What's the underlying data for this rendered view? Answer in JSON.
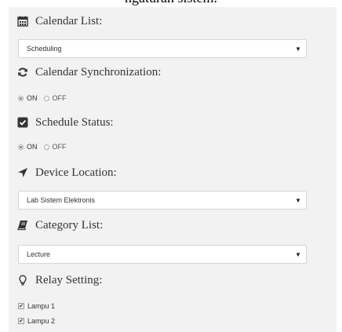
{
  "caption": "ngaturan sistem.",
  "calendar_list": {
    "label": "Calendar List:",
    "selected": "Scheduling"
  },
  "calendar_sync": {
    "label": "Calendar Synchronization:",
    "options": [
      "ON",
      "OFF"
    ],
    "selected": "ON"
  },
  "schedule_status": {
    "label": "Schedule Status:",
    "options": [
      "ON",
      "OFF"
    ],
    "selected": "ON"
  },
  "device_location": {
    "label": "Device Location:",
    "selected": "Lab Sistem Elektronis"
  },
  "category_list": {
    "label": "Category List:",
    "selected": "Lecture"
  },
  "relay_setting": {
    "label": "Relay Setting:",
    "items": [
      {
        "label": "Lampu 1",
        "checked": true
      },
      {
        "label": "Lampu 2",
        "checked": true
      }
    ]
  },
  "icons": {
    "calendar": "calendar-icon",
    "sync": "refresh-icon",
    "status": "checkbox-icon",
    "location": "location-arrow-icon",
    "category": "book-icon",
    "relay": "lightbulb-icon",
    "caret": "caret-down-icon"
  }
}
